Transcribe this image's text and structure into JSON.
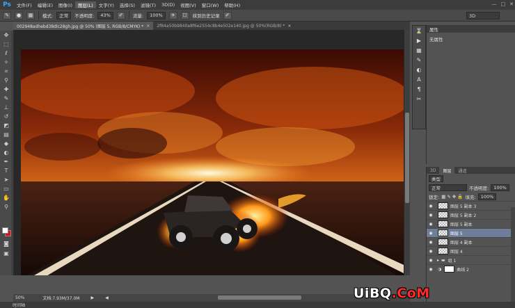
{
  "app": {
    "logo": "Ps"
  },
  "menu": [
    "文件(F)",
    "编辑(E)",
    "图像(I)",
    "图层(L)",
    "文字(Y)",
    "选择(S)",
    "滤镜(T)",
    "3D(D)",
    "视图(V)",
    "窗口(W)",
    "帮助(H)"
  ],
  "window_controls": [
    "—",
    "□",
    "✕"
  ],
  "options": {
    "mode_label": "模式:",
    "mode_value": "正常",
    "opacity_label": "不透明度:",
    "opacity_value": "43%",
    "flow_label": "流量:",
    "flow_value": "100%",
    "history_label": "抹到历史记录",
    "workspace": "3D"
  },
  "tabs": [
    {
      "label": "002948adhebd38dlc28gh.jpg @ 50% (图层 5, RGB/8/CMYK) *",
      "active": true
    },
    {
      "label": "2f84a50b9840a8f6e2554c8b4e502e140.jpg @ 50%(RGB/8) *",
      "active": false
    }
  ],
  "status": {
    "zoom": "50%",
    "doc": "文档:7.93M/37.0M",
    "timeline": "时间轴"
  },
  "properties": {
    "title": "属性",
    "subtitle": "无属性"
  },
  "layers_panel": {
    "tabs": [
      "3D",
      "图层",
      "通道"
    ],
    "filter": "类型",
    "blend": "正常",
    "opacity_label": "不透明度:",
    "opacity": "100%",
    "lock_label": "锁定:",
    "fill_label": "填充:",
    "fill": "100%",
    "layers": [
      {
        "name": "图层 5 副本 3",
        "selected": false,
        "type": "layer"
      },
      {
        "name": "图层 5 副本 2",
        "selected": false,
        "type": "layer"
      },
      {
        "name": "图层 5 副本",
        "selected": false,
        "type": "layer"
      },
      {
        "name": "图层 5",
        "selected": true,
        "type": "layer"
      },
      {
        "name": "图层 4 副本",
        "selected": false,
        "type": "layer"
      },
      {
        "name": "图层 4",
        "selected": false,
        "type": "layer"
      },
      {
        "name": "组 1",
        "selected": false,
        "type": "group"
      },
      {
        "name": "曲线 2",
        "selected": false,
        "type": "adjust"
      }
    ]
  },
  "watermark": {
    "main": "UiBQ",
    "suffix": ".CoM"
  },
  "colors": {
    "fg": "#ffffff",
    "bg": "#e10f1e",
    "selection": "#6e7d99"
  }
}
